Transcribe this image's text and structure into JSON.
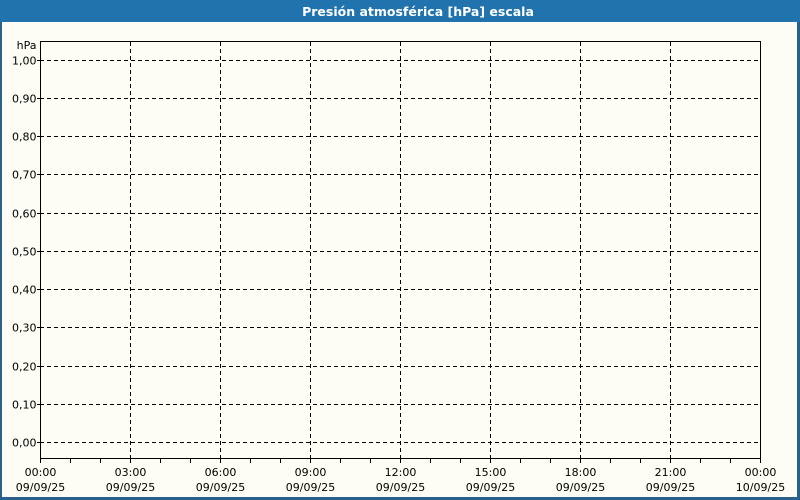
{
  "window": {
    "title_bar": {
      "title": "Presión atmosférica [hPa] escala"
    },
    "colors": {
      "header_bg": "#2173ae",
      "frame_border": "#2a608c",
      "page_bg": "#fdfdf6",
      "grid_line": "#000000",
      "label_text": "#000000",
      "title_text": "#ffffff"
    }
  },
  "chart_data": {
    "type": "line",
    "title": "Presión atmosférica [hPa] escala",
    "xlabel": "",
    "ylabel": "hPa",
    "ylim": [
      0.0,
      1.0
    ],
    "y_tick_step": 0.1,
    "grid": "dashed",
    "legend": "none",
    "series": [],
    "y_ticks": [
      {
        "value": 1.0,
        "label": "1,00"
      },
      {
        "value": 0.9,
        "label": "0,90"
      },
      {
        "value": 0.8,
        "label": "0,80"
      },
      {
        "value": 0.7,
        "label": "0,70"
      },
      {
        "value": 0.6,
        "label": "0,60"
      },
      {
        "value": 0.5,
        "label": "0,50"
      },
      {
        "value": 0.4,
        "label": "0,40"
      },
      {
        "value": 0.3,
        "label": "0,30"
      },
      {
        "value": 0.2,
        "label": "0,20"
      },
      {
        "value": 0.1,
        "label": "0,10"
      },
      {
        "value": 0.0,
        "label": "0,00"
      }
    ],
    "x_ticks": [
      {
        "hour": 0,
        "time": "00:00",
        "date": "09/09/25"
      },
      {
        "hour": 3,
        "time": "03:00",
        "date": "09/09/25"
      },
      {
        "hour": 6,
        "time": "06:00",
        "date": "09/09/25"
      },
      {
        "hour": 9,
        "time": "09:00",
        "date": "09/09/25"
      },
      {
        "hour": 12,
        "time": "12:00",
        "date": "09/09/25"
      },
      {
        "hour": 15,
        "time": "15:00",
        "date": "09/09/25"
      },
      {
        "hour": 18,
        "time": "18:00",
        "date": "09/09/25"
      },
      {
        "hour": 21,
        "time": "21:00",
        "date": "09/09/25"
      },
      {
        "hour": 24,
        "time": "00:00",
        "date": "10/09/25"
      }
    ],
    "x_minor_tick_interval_hours": 1
  }
}
